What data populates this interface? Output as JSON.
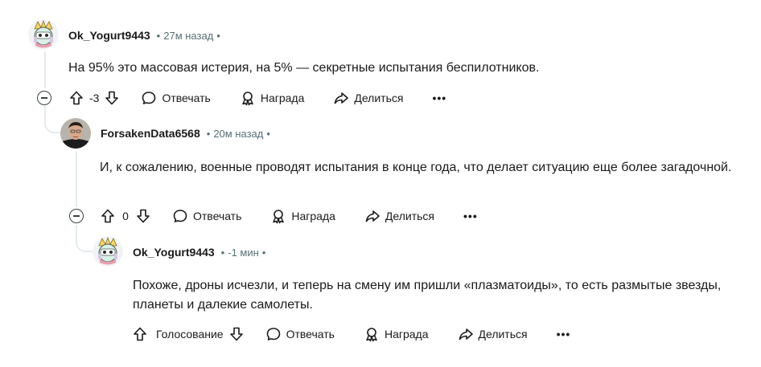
{
  "colors": {
    "meta": "#576f76",
    "text": "#1a1a1b",
    "line": "#e5ebee"
  },
  "comments": [
    {
      "author": "Ok_Yogurt9443",
      "time": "27м назад",
      "dot": "•",
      "dot_after": "•",
      "body": "На 95% это массовая истерия, на 5% — секретные испытания беспилотников.",
      "score": "-3",
      "reply_label": "Отвечать",
      "award_label": "Награда",
      "share_label": "Делиться",
      "more_label": "•••"
    },
    {
      "author": "ForsakenData6568",
      "time": "20м назад",
      "dot": "•",
      "dot_after": "•",
      "body": "И, к сожалению, военные проводят испытания в конце года, что делает ситуацию еще более загадочной.",
      "score": "0",
      "reply_label": "Отвечать",
      "award_label": "Награда",
      "share_label": "Делиться",
      "more_label": "•••"
    },
    {
      "author": "Ok_Yogurt9443",
      "time": "-1 мин",
      "dot": "•",
      "dot_after": "•",
      "body": "Похоже, дроны исчезли, и теперь на смену им пришли «плазматоиды», то есть размытые звезды, планеты и далекие самолеты.",
      "vote_label": "Голосование",
      "reply_label": "Отвечать",
      "award_label": "Награда",
      "share_label": "Делиться",
      "more_label": "•••"
    }
  ]
}
